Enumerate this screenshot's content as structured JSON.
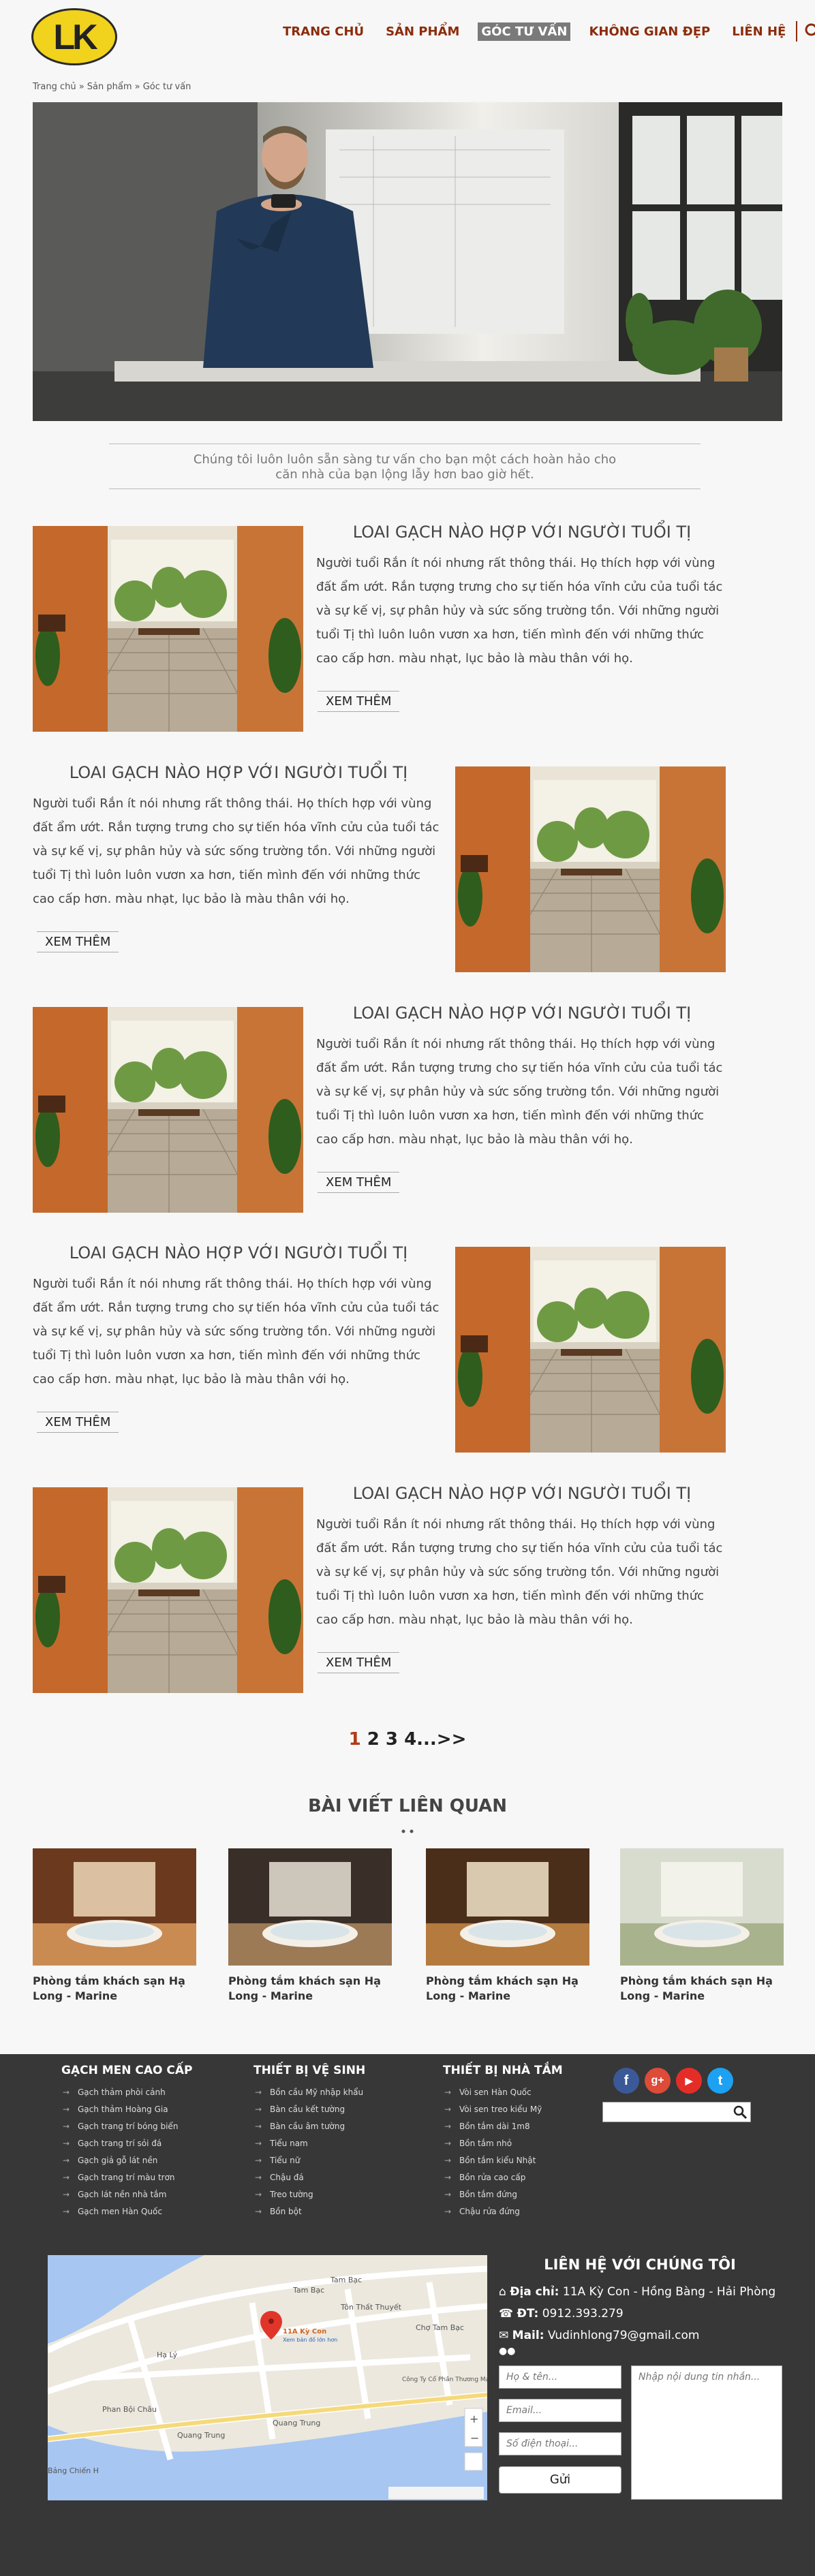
{
  "logo": {
    "text": "LK"
  },
  "nav": {
    "items": [
      "TRANG CHỦ",
      "SẢN PHẨM",
      "GÓC TƯ VẤN",
      "KHÔNG GIAN ĐẸP",
      "LIÊN HỆ"
    ]
  },
  "breadcrumb": "Trang chủ » Sản phẩm » Góc tư vấn",
  "intro": {
    "line1": "Chúng tôi luôn luôn sẵn sàng tư vấn cho bạn một cách hoàn hảo cho",
    "line2": "căn nhà của bạn lộng lẫy hơn bao giờ hết."
  },
  "article": {
    "title": "LOAI GẠCH NÀO HỢP VỚI NGƯỜI TUỔI TỊ",
    "body": "Người tuổi Rắn ít nói nhưng rất thông thái. Họ thích hợp với vùng đất ẩm ướt. Rắn tượng trưng cho sự tiến hóa vĩnh cửu của tuổi tác và sự kế vị, sự phân hủy và sức sống trường tồn. Với những người tuổi Tị thì luôn luôn vươn xa hơn, tiến mình đến với những thức cao cấp hơn. màu nhạt, lục bảo là màu thân với họ.",
    "more": "XEM THÊM"
  },
  "pagination": {
    "current": "1",
    "rest": "2 3 4...>>"
  },
  "related": {
    "title": "BÀI VIẾT LIÊN QUAN",
    "items": [
      {
        "caption": "Phòng tắm khách sạn Hạ Long - Marine"
      },
      {
        "caption": "Phòng tắm khách sạn Hạ Long - Marine"
      },
      {
        "caption": "Phòng tắm khách sạn Hạ Long - Marine"
      },
      {
        "caption": "Phòng tắm khách sạn Hạ Long - Marine"
      }
    ]
  },
  "footer": {
    "col1": {
      "title": "GẠCH MEN CAO CẤP",
      "items": [
        "Gạch thảm phòi cảnh",
        "Gạch thảm Hoàng Gia",
        "Gạch trang trí bóng biển",
        "Gạch trang trí sỏi đá",
        "Gạch giả gỗ lát nền",
        "Gạch trang trí màu trơn",
        "Gạch lát nền nhà tắm",
        "Gạch men Hàn Quốc"
      ]
    },
    "col2": {
      "title": "THIẾT BỊ VỆ SINH",
      "items": [
        "Bồn cầu Mỹ nhập khẩu",
        "Bàn cầu kết tường",
        "Bàn cầu âm tường",
        "Tiểu nam",
        "Tiểu nữ",
        "Chậu đá",
        "Treo tường",
        "Bồn bột"
      ]
    },
    "col3": {
      "title": "THIẾT BỊ NHÀ TẮM",
      "items": [
        "Vòi sen Hàn Quốc",
        "Vòi sen treo kiểu Mỹ",
        "Bồn tắm dài 1m8",
        "Bồn tắm nhỏ",
        "Bồn tắm kiểu Nhật",
        "Bồn rửa cao cấp",
        "Bồn tắm đứng",
        "Chậu rửa đứng"
      ]
    },
    "social": [
      "f",
      "g+",
      "▶",
      "t"
    ],
    "contact_title": "LIÊN HỆ VỚI CHÚNG TÔI",
    "address_label": "Địa chỉ:",
    "address": "11A Kỳ Con - Hồng Bàng - Hải Phòng",
    "phone_label": "ĐT:",
    "phone": "0912.393.279",
    "mail_label": "Mail:",
    "mail": "Vudinhlong79@gmail.com",
    "form": {
      "name": "Họ & tên...",
      "email": "Email...",
      "tel": "Số điện thoại...",
      "message": "Nhập nội dung tin nhắn...",
      "send": "Gửi"
    },
    "map": {
      "pin_label": "11A Kỳ Con",
      "pin_sub": "Xem bản đồ lớn hơn",
      "streets": [
        "Tam Bạc",
        "Tam Bạc",
        "Tôn Thất Thuyết",
        "Hạ Lý",
        "Phan Bội Châu",
        "Quang Trung",
        "Quang Trung",
        "Chợ Tam Bạc",
        "Công Ty Cổ Phần Thương Mại Thiết Bị...",
        "Bảng Chiến H"
      ]
    },
    "colors": {
      "footer_bg": "#373737",
      "accent": "#8b2c0c",
      "facebook": "#3b5998",
      "google": "#dd4b39",
      "youtube": "#e52d27",
      "twitter": "#1da1f2"
    }
  }
}
